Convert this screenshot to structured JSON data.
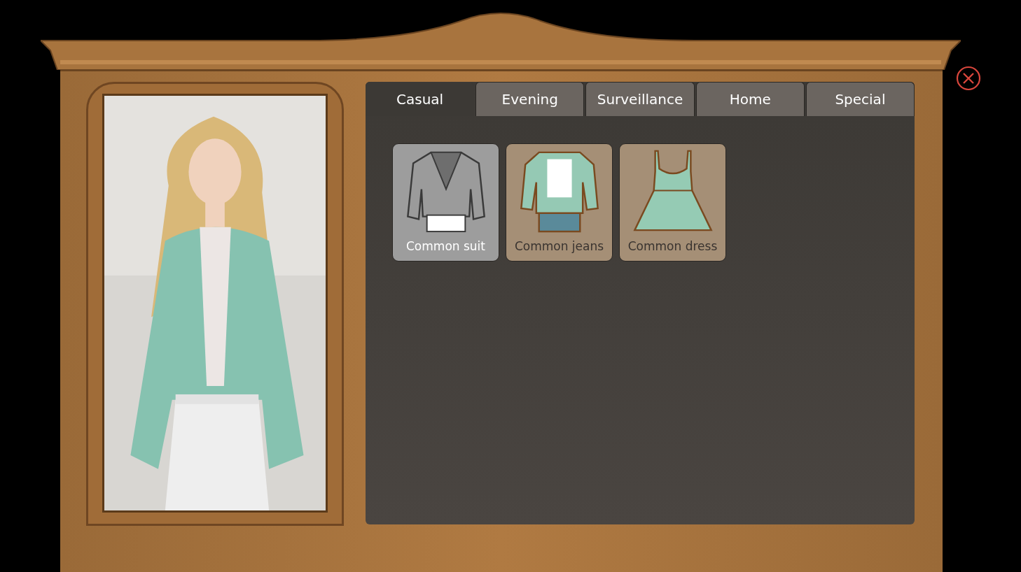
{
  "tabs": [
    {
      "label": "Casual",
      "selected": true
    },
    {
      "label": "Evening",
      "selected": false
    },
    {
      "label": "Surveillance",
      "selected": false
    },
    {
      "label": "Home",
      "selected": false
    },
    {
      "label": "Special",
      "selected": false
    }
  ],
  "outfits": [
    {
      "kind": "suit",
      "label": "Common suit",
      "selected": true
    },
    {
      "kind": "jeans",
      "label": "Common jeans",
      "selected": false
    },
    {
      "kind": "dress",
      "label": "Common dress",
      "selected": false
    }
  ]
}
